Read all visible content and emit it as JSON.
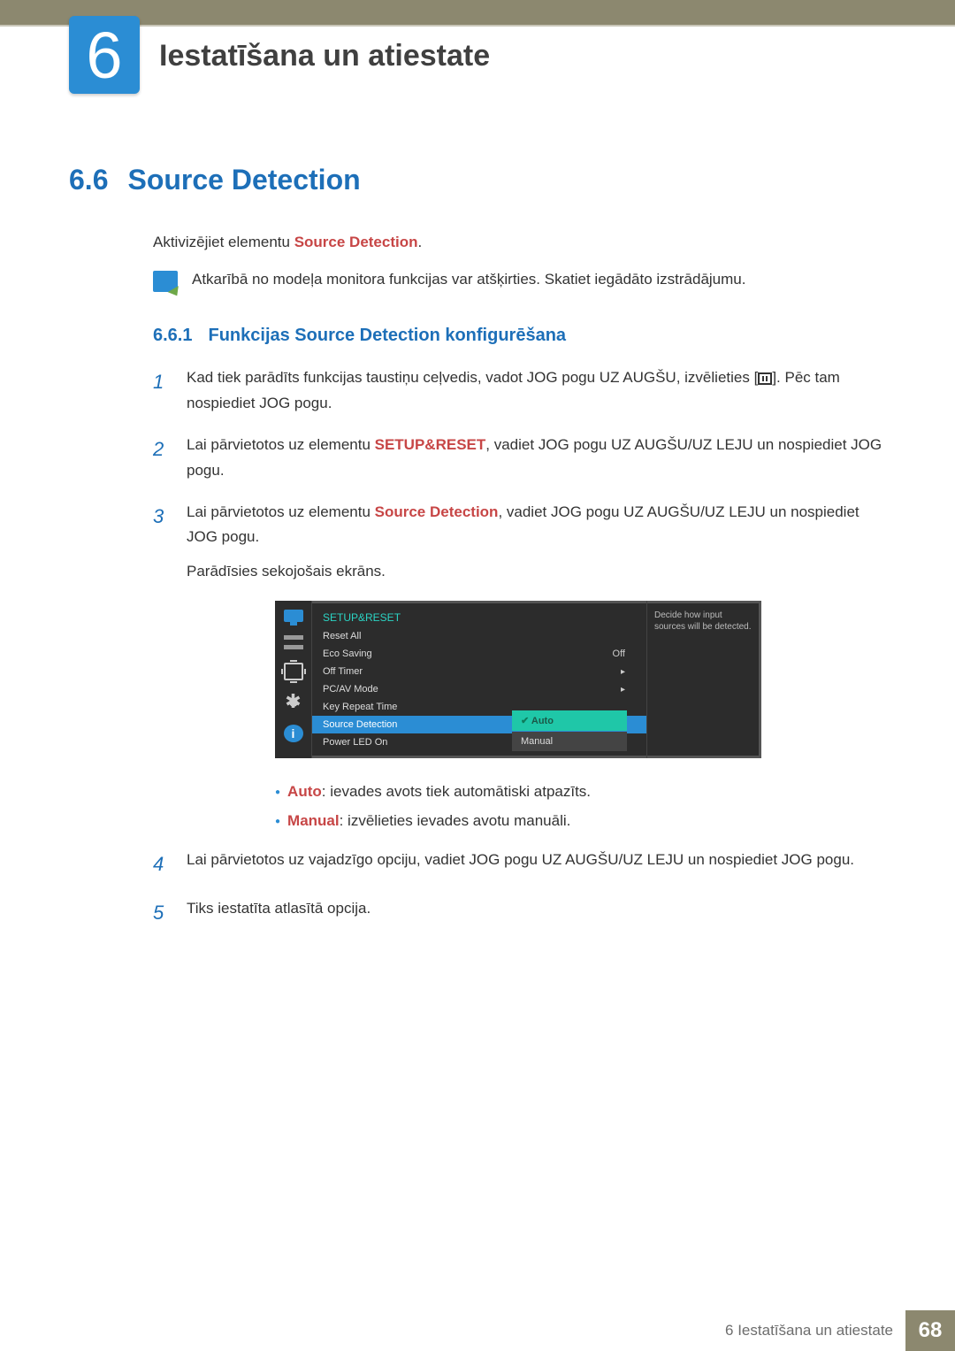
{
  "chapter": {
    "number": "6",
    "title": "Iestatīšana un atiestate"
  },
  "section": {
    "number": "6.6",
    "title": "Source Detection"
  },
  "intro": {
    "prefix": "Aktivizējiet elementu ",
    "kw": "Source Detection",
    "suffix": "."
  },
  "note": "Atkarībā no modeļa monitora funkcijas var atšķirties. Skatiet iegādāto izstrādājumu.",
  "subsection": {
    "number": "6.6.1",
    "title": "Funkcijas Source Detection konfigurēšana"
  },
  "steps": {
    "s1": {
      "num": "1",
      "a": "Kad tiek parādīts funkcijas taustiņu ceļvedis, vadot JOG pogu UZ AUGŠU, izvēlieties [",
      "b": "]. Pēc tam nospiediet JOG pogu."
    },
    "s2": {
      "num": "2",
      "a": "Lai pārvietotos uz elementu ",
      "kw": "SETUP&RESET",
      "b": ", vadiet JOG pogu UZ AUGŠU/UZ LEJU un nospiediet JOG pogu."
    },
    "s3": {
      "num": "3",
      "a": "Lai pārvietotos uz elementu ",
      "kw": "Source Detection",
      "b": ", vadiet JOG pogu UZ AUGŠU/UZ LEJU un nospiediet JOG pogu.",
      "c": "Parādīsies sekojošais ekrāns."
    },
    "s4": {
      "num": "4",
      "a": "Lai pārvietotos uz vajadzīgo opciju, vadiet JOG pogu UZ AUGŠU/UZ LEJU un nospiediet JOG pogu."
    },
    "s5": {
      "num": "5",
      "a": "Tiks iestatīta atlasītā opcija."
    }
  },
  "osd": {
    "header": "SETUP&RESET",
    "rows": {
      "r1": {
        "lbl": "Reset All",
        "val": ""
      },
      "r2": {
        "lbl": "Eco Saving",
        "val": "Off"
      },
      "r3": {
        "lbl": "Off Timer",
        "val": "▸"
      },
      "r4": {
        "lbl": "PC/AV Mode",
        "val": "▸"
      },
      "r5": {
        "lbl": "Key Repeat Time",
        "val": ""
      },
      "r6": {
        "lbl": "Source Detection",
        "val": ""
      },
      "r7": {
        "lbl": "Power LED On",
        "val": ""
      }
    },
    "submenu": {
      "opt1": "Auto",
      "opt2": "Manual"
    },
    "sidebar_info": "i",
    "help": "Decide how input sources will be detected."
  },
  "bullets": {
    "b1": {
      "kw": "Auto",
      "txt": ": ievades avots tiek automātiski atpazīts."
    },
    "b2": {
      "kw": "Manual",
      "txt": ": izvēlieties ievades avotu manuāli."
    }
  },
  "footer": {
    "text": "6 Iestatīšana un atiestate",
    "page": "68"
  }
}
